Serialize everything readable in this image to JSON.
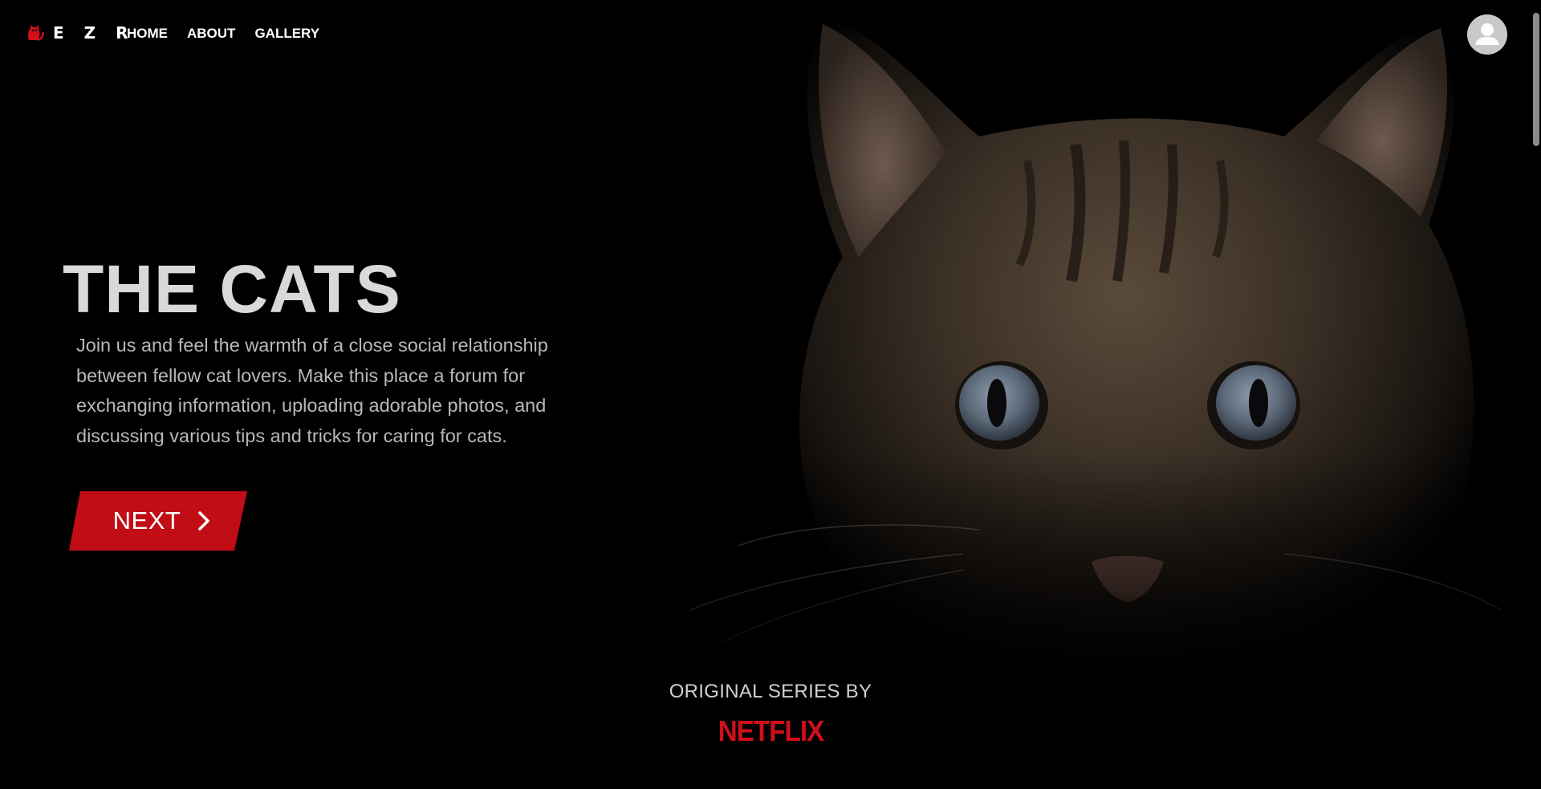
{
  "header": {
    "logo_text": "E Z R",
    "logo_icon": "cat-icon",
    "nav": [
      {
        "label": "HOME"
      },
      {
        "label": "ABOUT"
      },
      {
        "label": "GALLERY"
      }
    ],
    "avatar_icon": "user-icon"
  },
  "hero": {
    "title": "THE CATS",
    "description": "Join us and feel the warmth of a close social relationship between fellow cat lovers. Make this place a forum for exchanging information, uploading adorable photos, and discussing various tips and tricks for caring for cats.",
    "next_label": "NEXT",
    "next_icon": "chevron-right-icon",
    "image": "cat-face-photo"
  },
  "credit": {
    "text": "ORIGINAL SERIES BY",
    "brand": "NETFLIX"
  },
  "colors": {
    "background": "#000000",
    "accent": "#c10d16",
    "brand": "#d00f1b",
    "title": "#d9d9d9",
    "body_text": "#b8b8b8"
  }
}
